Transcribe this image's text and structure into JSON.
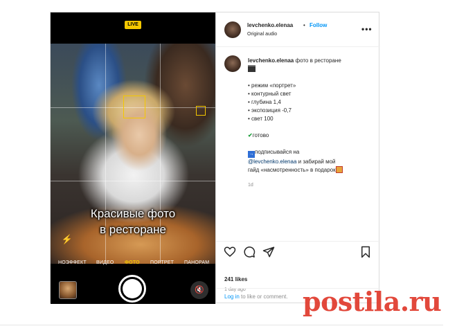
{
  "media": {
    "live_badge": "LIVE",
    "overlay_line1": "Красивые фото",
    "overlay_line2": "в ресторане",
    "modes": [
      "НОЭФФЕКТ",
      "ВИДЕО",
      "ФОТО",
      "ПОРТРЕТ",
      "ПАНОРАМ"
    ],
    "active_mode": "ФОТО",
    "accent_color": "#f4c800"
  },
  "header": {
    "username": "levchenko.elenaa",
    "dot": "•",
    "follow_label": "Follow",
    "subtitle": "Original audio",
    "more_icon": "more-icon"
  },
  "caption": {
    "username": "levchenko.elenaa",
    "title": "фото в ресторане",
    "bullets": [
      "• режим «портрет»",
      "• контурный свет",
      "• глубина 1,4",
      "• экспозиция -0,7",
      "• свет 100"
    ],
    "done": "готово",
    "cta_prefix": "подписывайся на",
    "mention": "@levchenko.elenaa",
    "cta_suffix": "и забирай мой",
    "cta_line3": "гайд «насмотренность» в подарок",
    "age": "1d"
  },
  "actions": {
    "likes": "241 likes",
    "posted": "1 day ago",
    "login_link": "Log in",
    "login_text": "to like or comment."
  },
  "watermark": "postila.ru",
  "colors": {
    "link": "#0095f6",
    "mention": "#00376b",
    "watermark": "#e0392b"
  }
}
